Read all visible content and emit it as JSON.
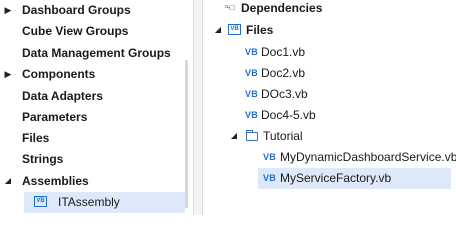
{
  "left_tree": {
    "items": [
      {
        "label": "Dashboard Groups",
        "expander": "collapsed"
      },
      {
        "label": "Cube View Groups",
        "expander": "none"
      },
      {
        "label": "Data Management Groups",
        "expander": "none"
      },
      {
        "label": "Components",
        "expander": "collapsed"
      },
      {
        "label": "Data Adapters",
        "expander": "none"
      },
      {
        "label": "Parameters",
        "expander": "none"
      },
      {
        "label": "Files",
        "expander": "none"
      },
      {
        "label": "Strings",
        "expander": "none"
      },
      {
        "label": "Assemblies",
        "expander": "expanded"
      }
    ],
    "child": {
      "label": "ITAssembly",
      "icon": "vb-assembly-icon",
      "icon_text": "VB",
      "selected": true
    }
  },
  "right_tree": {
    "dependencies": {
      "label": "Dependencies",
      "icon": "dependencies-icon",
      "icon_text": "ᵒ-□"
    },
    "files": {
      "label": "Files",
      "icon": "vb-folder-icon",
      "icon_text": "VB",
      "expander": "expanded"
    },
    "docs": [
      {
        "label": "Doc1.vb",
        "icon_text": "VB"
      },
      {
        "label": "Doc2.vb",
        "icon_text": "VB"
      },
      {
        "label": "DOc3.vb",
        "icon_text": "VB"
      },
      {
        "label": "Doc4-5.vb",
        "icon_text": "VB"
      }
    ],
    "tutorial": {
      "label": "Tutorial",
      "icon": "folder-icon",
      "expander": "expanded"
    },
    "tutorial_files": [
      {
        "label": "MyDynamicDashboardService.vb",
        "icon_text": "VB",
        "selected": false
      },
      {
        "label": "MyServiceFactory.vb",
        "icon_text": "VB",
        "selected": true
      }
    ]
  },
  "colors": {
    "accent": "#1f6fd1",
    "selection": "#dde8f8"
  }
}
